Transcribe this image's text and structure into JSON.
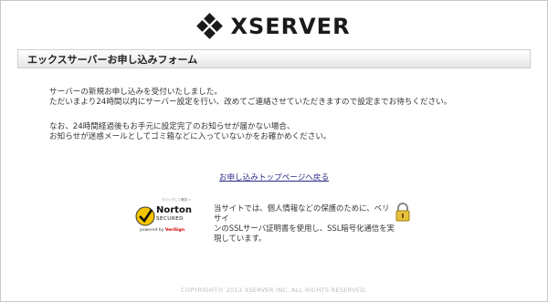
{
  "logo": {
    "text": "XSERVER",
    "icon": "xserver-diamond-logo"
  },
  "form_title": "エックスサーバーお申し込みフォーム",
  "message": {
    "line1": "サーバーの新規お申し込みを受付いたしました。",
    "line2": "ただいまより24時間以内にサーバー設定を行い、改めてご連絡させていただきますので設定までお待ちください。",
    "line3": "なお、24時間経過後もお手元に設定完了のお知らせが届かない場合、",
    "line4": "お知らせが迷惑メールとしてゴミ箱などに入っていないかをお確かめください。"
  },
  "back_link": "お申し込みトップページへ戻る",
  "norton": {
    "top_small": "クリックして確認 >",
    "brand": "Norton",
    "secured": "SECURED",
    "powered_prefix": "powered by ",
    "powered_brand": "VeriSign",
    "icon": "norton-check-icon"
  },
  "ssl_notice": {
    "line1": "当サイトでは、個人情報などの保護のために、ベリサイ",
    "line2": "ンのSSLサーバ証明書を使用し、SSL暗号化通信を実",
    "line3": "現しています。",
    "icon": "padlock-icon"
  },
  "footer": "COPYRIGHT© 2013 XSERVER INC. ALL RIGHTS RESERVED.",
  "colors": {
    "norton_yellow": "#f5c400",
    "link": "#2a2a88",
    "verisign_red": "#cc0000"
  }
}
